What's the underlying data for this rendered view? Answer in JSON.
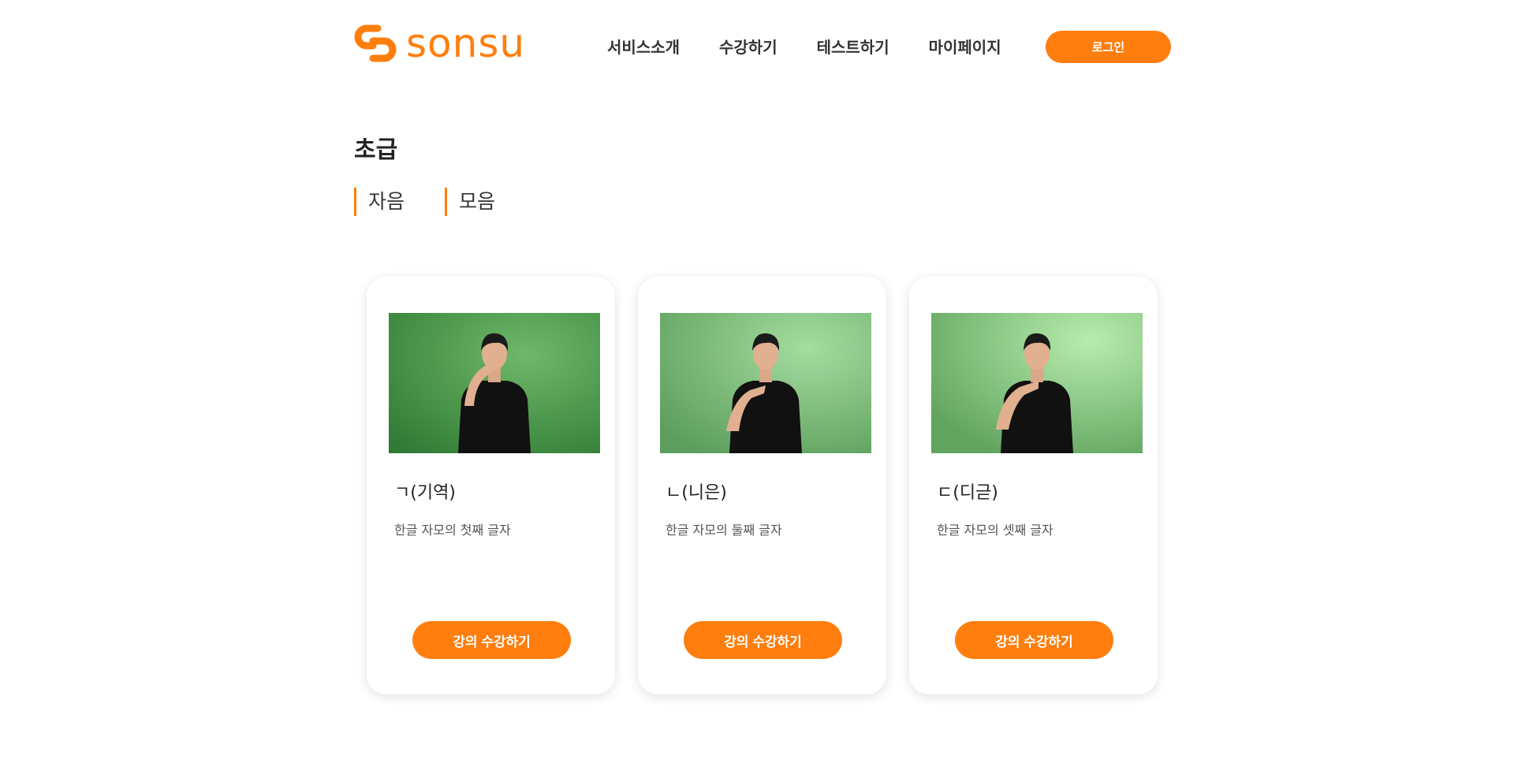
{
  "brand": {
    "logo_text": "sonsu",
    "accent_color": "#ff7e0d"
  },
  "nav": {
    "items": [
      {
        "label": "서비스소개"
      },
      {
        "label": "수강하기"
      },
      {
        "label": "테스트하기"
      },
      {
        "label": "마이페이지"
      }
    ],
    "login_label": "로그인"
  },
  "page": {
    "title": "초급"
  },
  "tabs": [
    {
      "label": "자음"
    },
    {
      "label": "모음"
    }
  ],
  "lessons": [
    {
      "title": "ㄱ(기역)",
      "description": "한글 자모의 첫째 글자",
      "button_label": "강의 수강하기",
      "thumbnail": "sign-language-video-thumbnail"
    },
    {
      "title": "ㄴ(니은)",
      "description": "한글 자모의 둘째 글자",
      "button_label": "강의 수강하기",
      "thumbnail": "sign-language-video-thumbnail"
    },
    {
      "title": "ㄷ(디귿)",
      "description": "한글 자모의 셋째 글자",
      "button_label": "강의 수강하기",
      "thumbnail": "sign-language-video-thumbnail"
    }
  ]
}
